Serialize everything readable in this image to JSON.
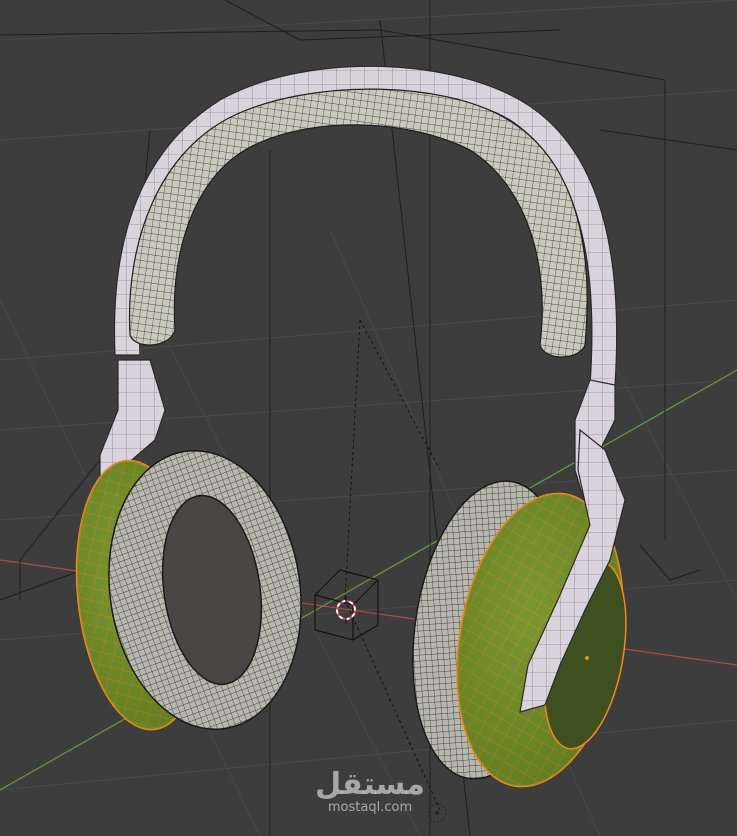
{
  "viewport": {
    "background": "#3d3d3d",
    "grid_color": "#4a4a4a",
    "x_axis_color": "#b04848",
    "y_axis_color": "#6a9a3a"
  },
  "model": {
    "shell_color": "#d9d3dc",
    "headband_cushion_color": "#c9c9be",
    "earcup_selected_color": "#6f8a2a",
    "selection_outline_color": "#f08a1a",
    "wire_color": "#2a2a2a"
  },
  "icons": {
    "origin": "origin-icon",
    "light": "light-empty-icon",
    "cursor": "3d-cursor-icon"
  },
  "watermark": {
    "main": "مستقل",
    "sub": "mostaql.com"
  }
}
